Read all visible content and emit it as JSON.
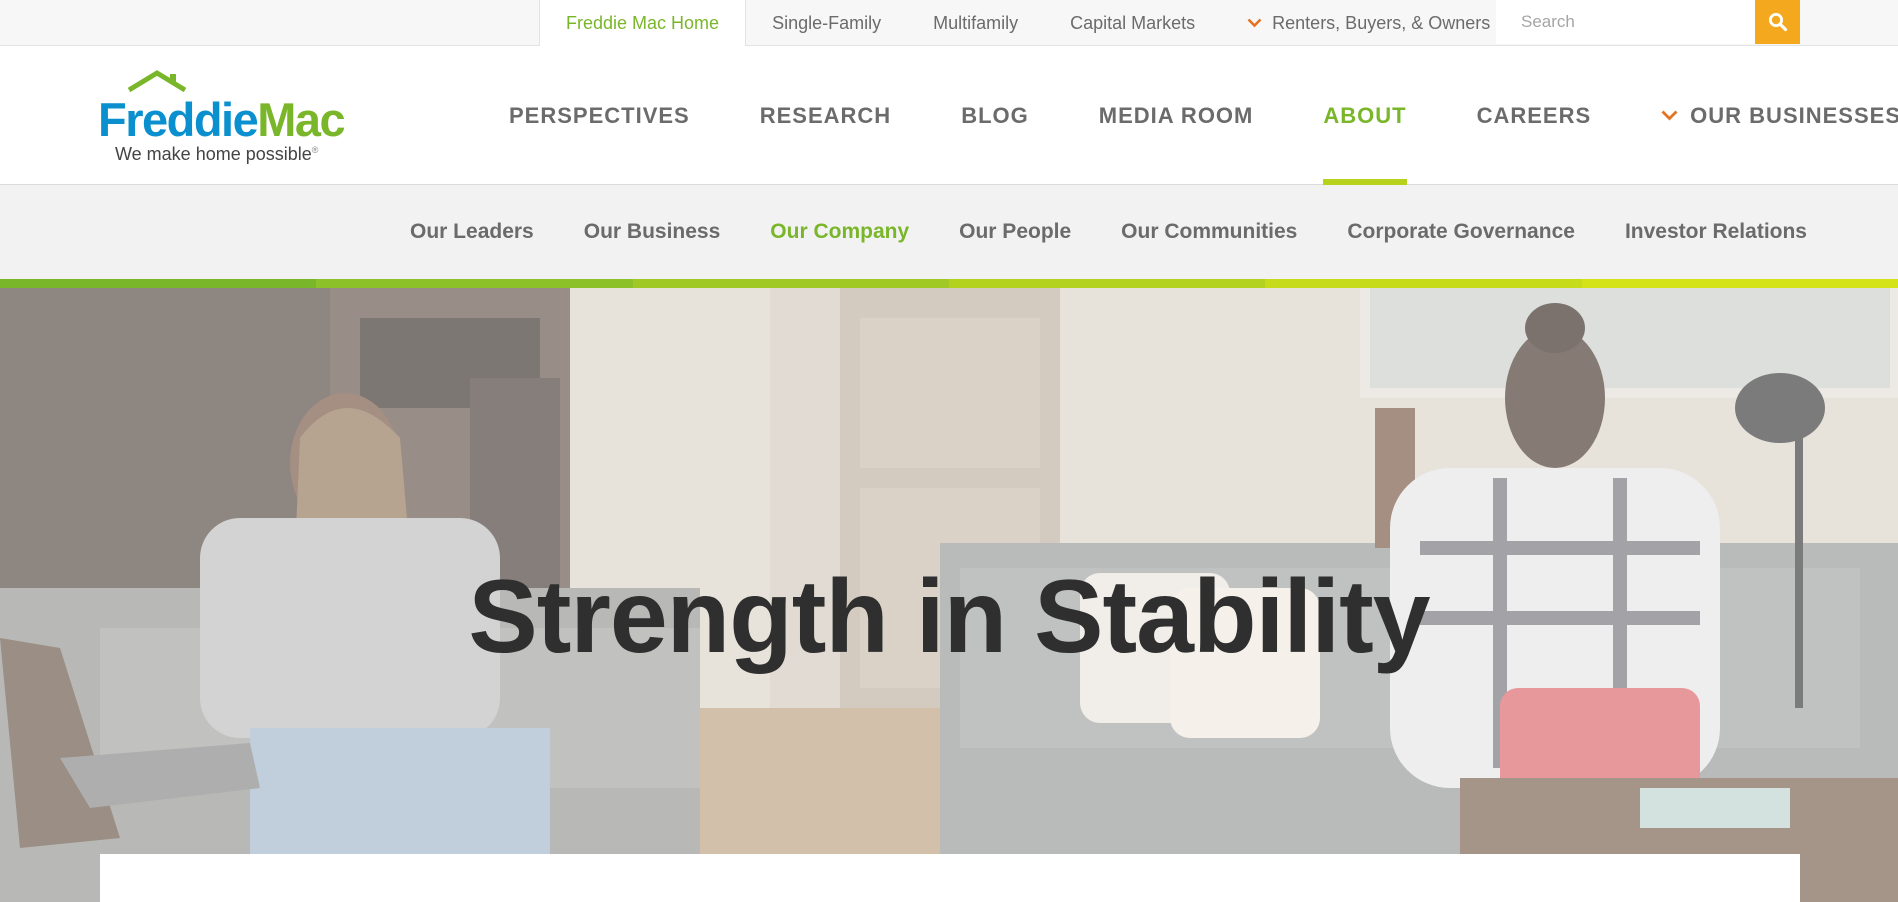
{
  "utility_nav": {
    "links": [
      {
        "label": "Freddie Mac Home",
        "active": true
      },
      {
        "label": "Single-Family"
      },
      {
        "label": "Multifamily"
      },
      {
        "label": "Capital Markets"
      },
      {
        "label": "Renters, Buyers, & Owners",
        "has_dropdown": true
      }
    ],
    "search": {
      "placeholder": "Search",
      "icon": "search-icon"
    }
  },
  "logo": {
    "word_first": "Freddie",
    "word_second": "Mac",
    "tagline": "We make home possible",
    "tagline_mark": "®",
    "icon": "house-roof-icon"
  },
  "main_nav": {
    "items": [
      {
        "label": "PERSPECTIVES"
      },
      {
        "label": "RESEARCH"
      },
      {
        "label": "BLOG"
      },
      {
        "label": "MEDIA ROOM"
      },
      {
        "label": "ABOUT",
        "active": true
      },
      {
        "label": "CAREERS"
      },
      {
        "label": "OUR BUSINESSES",
        "has_dropdown": true
      }
    ]
  },
  "sub_nav": {
    "items": [
      {
        "label": "Our Leaders"
      },
      {
        "label": "Our Business"
      },
      {
        "label": "Our Company",
        "active": true
      },
      {
        "label": "Our People"
      },
      {
        "label": "Our Communities"
      },
      {
        "label": "Corporate Governance"
      },
      {
        "label": "Investor Relations"
      }
    ]
  },
  "hero": {
    "title": "Strength in Stability",
    "image": "two women working on laptops in a living room"
  },
  "colors": {
    "brand_green": "#7ab62a",
    "brand_blue": "#0a8fcf",
    "accent_orange": "#e37222",
    "search_button": "#f4a81d",
    "accent_bar": [
      "#7ab62a",
      "#8cc12a",
      "#a0c926",
      "#b2d21f",
      "#c6dc1a",
      "#d4e317"
    ]
  }
}
